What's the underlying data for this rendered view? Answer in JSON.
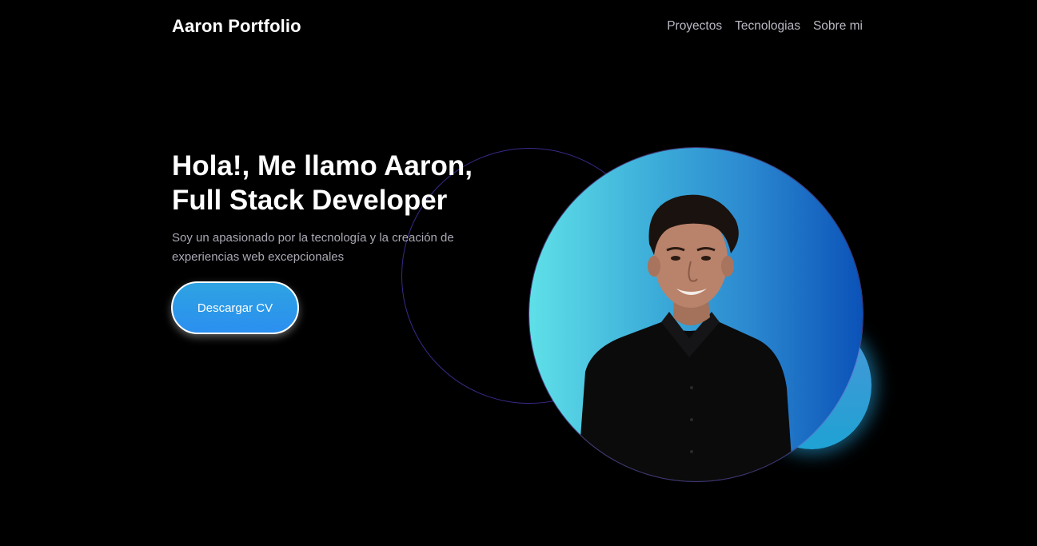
{
  "header": {
    "brand": "Aaron Portfolio",
    "nav": [
      "Proyectos",
      "Tecnologias",
      "Sobre mi"
    ]
  },
  "hero": {
    "title_line1": "Hola!, Me llamo Aaron,",
    "title_line2": "Full Stack Developer",
    "subtitle": "Soy un apasionado por la tecnología y la creación de experiencias web excepcionales",
    "cta_label": "Descargar CV"
  },
  "colors": {
    "background": "#000000",
    "accent": "#2b8ff0",
    "photo_gradient_start": "#5fe0e8",
    "photo_gradient_end": "#0b52b8"
  }
}
